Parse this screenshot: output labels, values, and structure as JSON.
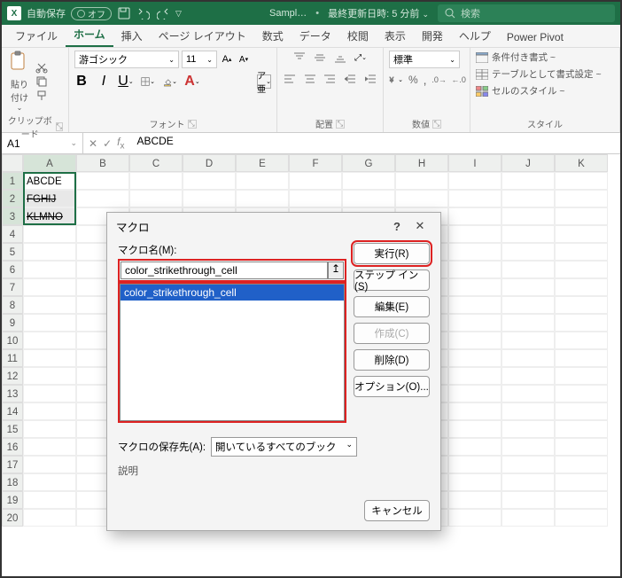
{
  "titlebar": {
    "autosave_label": "自動保存",
    "autosave_state": "オフ",
    "filename": "Sampl…",
    "last_saved_prefix": "最終更新日時:",
    "last_saved": "5 分前",
    "search_placeholder": "検索"
  },
  "tabs": [
    {
      "label": "ファイル",
      "active": false
    },
    {
      "label": "ホーム",
      "active": true
    },
    {
      "label": "挿入",
      "active": false
    },
    {
      "label": "ページ レイアウト",
      "active": false
    },
    {
      "label": "数式",
      "active": false
    },
    {
      "label": "データ",
      "active": false
    },
    {
      "label": "校閲",
      "active": false
    },
    {
      "label": "表示",
      "active": false
    },
    {
      "label": "開発",
      "active": false
    },
    {
      "label": "ヘルプ",
      "active": false
    },
    {
      "label": "Power Pivot",
      "active": false
    }
  ],
  "ribbon": {
    "clipboard": {
      "paste_label": "貼り付け",
      "group_label": "クリップボード"
    },
    "font": {
      "name": "游ゴシック",
      "size": "11",
      "group_label": "フォント"
    },
    "align": {
      "group_label": "配置"
    },
    "number": {
      "format": "標準",
      "group_label": "数値"
    },
    "styles": {
      "cond": "条件付き書式 ~",
      "table": "テーブルとして書式設定 ~",
      "cell": "セルのスタイル ~",
      "group_label": "スタイル"
    }
  },
  "namebox": "A1",
  "formula": "ABCDE",
  "columns": [
    "A",
    "B",
    "C",
    "D",
    "E",
    "F",
    "G",
    "H",
    "I",
    "J",
    "K"
  ],
  "rows_visible": 20,
  "cells": {
    "A1": "ABCDE",
    "A2": "FGHIJ",
    "A3": "KLMNO"
  },
  "dialog": {
    "title": "マクロ",
    "macro_name_label": "マクロ名(M):",
    "macro_name_value": "color_strikethrough_cell",
    "list_item": "color_strikethrough_cell",
    "save_in_label": "マクロの保存先(A):",
    "save_in_value": "開いているすべてのブック",
    "description_label": "説明",
    "buttons": {
      "run": "実行(R)",
      "step": "ステップ イン(S)",
      "edit": "編集(E)",
      "create": "作成(C)",
      "delete": "削除(D)",
      "options": "オプション(O)...",
      "cancel": "キャンセル"
    }
  }
}
